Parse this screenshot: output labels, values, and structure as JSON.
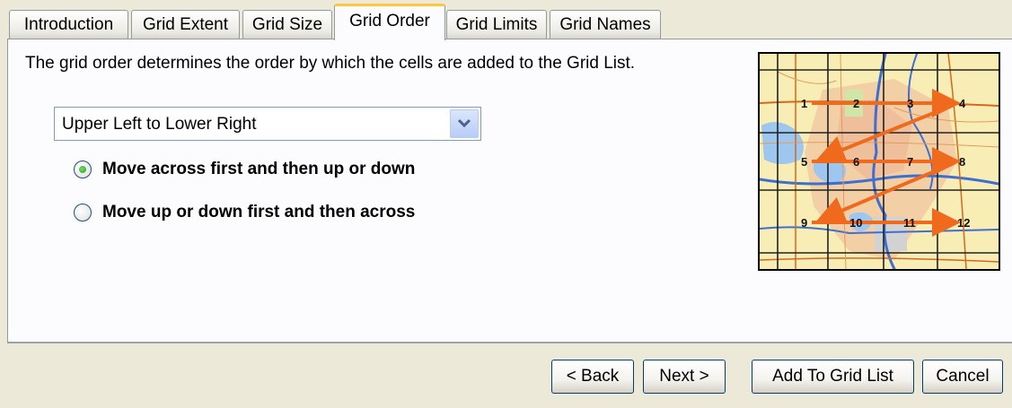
{
  "tabs": [
    {
      "label": "Introduction",
      "active": false
    },
    {
      "label": "Grid Extent",
      "active": false
    },
    {
      "label": "Grid Size",
      "active": false
    },
    {
      "label": "Grid Order",
      "active": true
    },
    {
      "label": "Grid Limits",
      "active": false
    },
    {
      "label": "Grid Names",
      "active": false
    }
  ],
  "panel": {
    "description": "The grid order determines the order by which the cells are added to the Grid List.",
    "order_select": {
      "selected": "Upper Left to Lower Right",
      "icon": "chevron-down-icon"
    },
    "radios": [
      {
        "label": "Move across first and then up or down",
        "checked": true
      },
      {
        "label": "Move up or down first and then across",
        "checked": false
      }
    ],
    "preview": {
      "cell_numbers": [
        "1",
        "2",
        "3",
        "4",
        "5",
        "6",
        "7",
        "8",
        "9",
        "10",
        "11",
        "12"
      ],
      "arrow_color": "#f06a1e"
    }
  },
  "buttons": {
    "back": "< Back",
    "next": "Next >",
    "add_to_grid_list": "Add To Grid List",
    "cancel": "Cancel"
  },
  "colors": {
    "dialog_bg": "#ece9d8",
    "panel_bg": "#fcfcfe",
    "active_tab_accent": "#ffc83c",
    "radio_check": "#21a121"
  }
}
